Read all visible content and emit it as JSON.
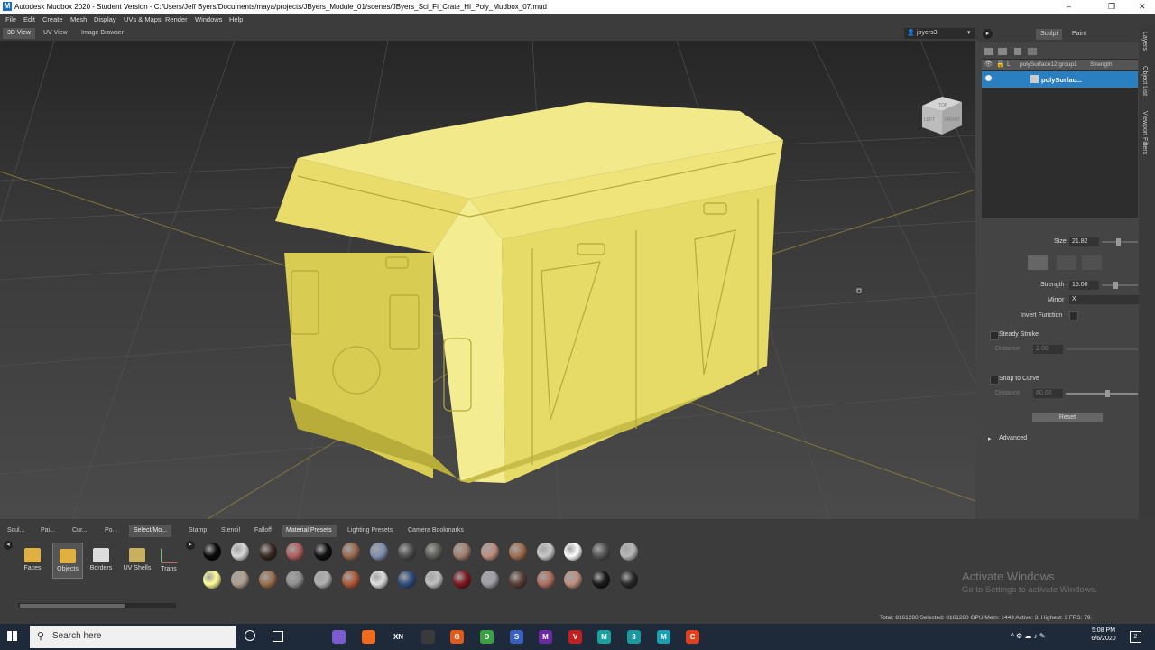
{
  "window": {
    "title": "Autodesk Mudbox 2020 - Student Version - C:/Users/Jeff Byers/Documents/maya/projects/JByers_Module_01/scenes/JByers_Sci_Fi_Crate_Hi_Poly_Mudbox_07.mud",
    "minimize": "–",
    "restore": "❐",
    "close": "✕"
  },
  "menu": [
    "File",
    "Edit",
    "Create",
    "Mesh",
    "Display",
    "UVs & Maps",
    "Render",
    "Windows",
    "Help"
  ],
  "view_tabs": [
    "3D View",
    "UV View",
    "Image Browser"
  ],
  "user": "jbyers3",
  "viewcube": {
    "top": "TOP",
    "left": "LEFT",
    "front": "FRONT"
  },
  "right_panel": {
    "tabs": [
      "Sculpt",
      "Paint"
    ],
    "layer_row": "polySurface12 group1",
    "layer_strength": "Strength",
    "layer_row_letter": "L",
    "selected_layer": "polySurfac...",
    "size_label": "Size",
    "size_value": "21.82",
    "strength_label": "Strength",
    "strength_value": "15.00",
    "mirror_label": "Mirror",
    "mirror_value": "X",
    "invert_label": "Invert Function",
    "steady_label": "Steady Stroke",
    "distance_label": "Distance",
    "distance1_value": "2.00",
    "snap_label": "Snap to Curve",
    "distance2_value": "60.00",
    "reset_label": "Reset",
    "advanced_label": "Advanced",
    "side_tabs": [
      "Layers",
      "Object List",
      "Viewport Filters"
    ]
  },
  "tray": {
    "tabs": [
      "Scul...",
      "Pai...",
      "Cur...",
      "Po...",
      "Select/Mo...",
      "Stamp",
      "Stencil",
      "Falloff",
      "Material Presets",
      "Lighting Presets",
      "Camera Bookmarks"
    ],
    "active_tab": "Material Presets",
    "tools": [
      "Faces",
      "Objects",
      "Borders",
      "UV Shells",
      "Trans"
    ],
    "material_colors_row1": [
      "#0a0a0a",
      "#d8d8d8",
      "#3a2a22",
      "#b06060",
      "#101010",
      "#9a6a50",
      "#8090b0",
      "#505050",
      "#606058",
      "#a08070",
      "#c09080",
      "#a07050",
      "#c8c8c8",
      "#ffffff",
      "#555555",
      "#b8b8b8"
    ],
    "material_colors_row2": [
      "#ffff99",
      "#b0a090",
      "#9a7050",
      "#909090",
      "#b0b0b0",
      "#b05a3a",
      "#e0e0e0",
      "#305080",
      "#c0c0c0",
      "#801820",
      "#a0a0a8",
      "#5a4038",
      "#b07060",
      "#c09080",
      "#1a1a1a",
      "#2a2a2a"
    ]
  },
  "watermark": {
    "title": "Activate Windows",
    "subtitle": "Go to Settings to activate Windows."
  },
  "status": "Total: 8161280  Selected: 8161280  GPU Mem: 1443  Active: 3, Highest: 3  FPS: 79.",
  "taskbar": {
    "search_placeholder": "Search here",
    "time": "5:08 PM",
    "date": "6/6/2020",
    "notif_count": "2",
    "apps": [
      {
        "letter": "",
        "color": "#7a5cd0"
      },
      {
        "letter": "",
        "color": "#f26b1d"
      },
      {
        "letter": "XN",
        "color": "#1e2a3a"
      },
      {
        "letter": "",
        "color": "#3a3a3a"
      },
      {
        "letter": "G",
        "color": "#e05a1a"
      },
      {
        "letter": "D",
        "color": "#3aa040"
      },
      {
        "letter": "S",
        "color": "#3a60c0"
      },
      {
        "letter": "M",
        "color": "#6a2aa0"
      },
      {
        "letter": "V",
        "color": "#c02020"
      },
      {
        "letter": "M",
        "color": "#1aa0a0"
      },
      {
        "letter": "3",
        "color": "#1a9aa0"
      },
      {
        "letter": "M",
        "color": "#1aa0b0"
      },
      {
        "letter": "C",
        "color": "#e04020"
      }
    ]
  }
}
